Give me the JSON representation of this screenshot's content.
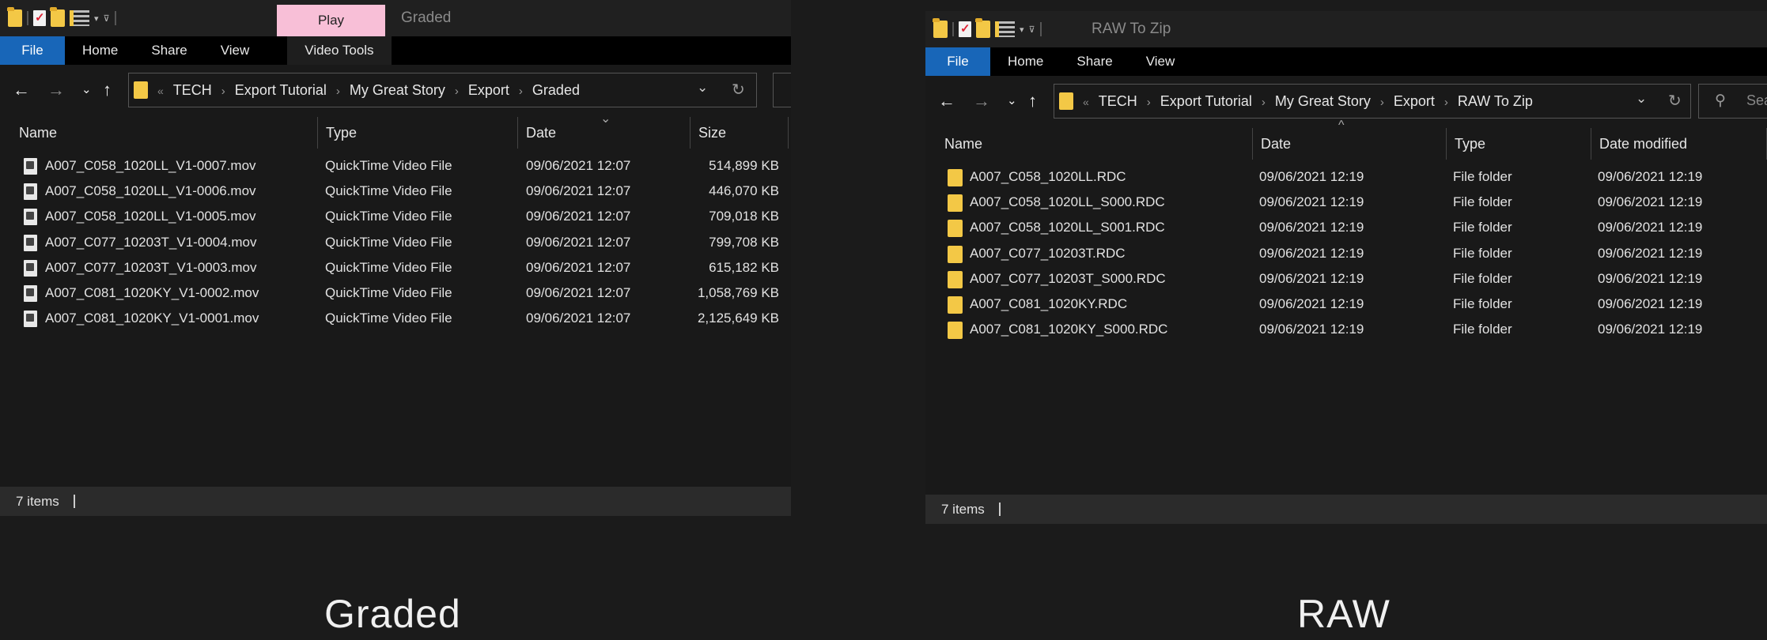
{
  "left_window": {
    "context_tab": "Play",
    "window_title": "Graded",
    "ribbon_tabs": [
      "File",
      "Home",
      "Share",
      "View",
      "Video Tools"
    ],
    "path": [
      "TECH",
      "Export Tutorial",
      "My Great Story",
      "Export",
      "Graded"
    ],
    "columns": [
      "Name",
      "Type",
      "Date",
      "Size"
    ],
    "rows": [
      {
        "name": "A007_C058_1020LL_V1-0007.mov",
        "type": "QuickTime Video File",
        "date": "09/06/2021 12:07",
        "size": "514,899 KB"
      },
      {
        "name": "A007_C058_1020LL_V1-0006.mov",
        "type": "QuickTime Video File",
        "date": "09/06/2021 12:07",
        "size": "446,070 KB"
      },
      {
        "name": "A007_C058_1020LL_V1-0005.mov",
        "type": "QuickTime Video File",
        "date": "09/06/2021 12:07",
        "size": "709,018 KB"
      },
      {
        "name": "A007_C077_10203T_V1-0004.mov",
        "type": "QuickTime Video File",
        "date": "09/06/2021 12:07",
        "size": "799,708 KB"
      },
      {
        "name": "A007_C077_10203T_V1-0003.mov",
        "type": "QuickTime Video File",
        "date": "09/06/2021 12:07",
        "size": "615,182 KB"
      },
      {
        "name": "A007_C081_1020KY_V1-0002.mov",
        "type": "QuickTime Video File",
        "date": "09/06/2021 12:07",
        "size": "1,058,769 KB"
      },
      {
        "name": "A007_C081_1020KY_V1-0001.mov",
        "type": "QuickTime Video File",
        "date": "09/06/2021 12:07",
        "size": "2,125,649 KB"
      }
    ],
    "status": "7 items",
    "icons": {
      "file_row": "video-file-icon",
      "folder": "folder-icon"
    }
  },
  "right_window": {
    "window_title": "RAW To Zip",
    "ribbon_tabs": [
      "File",
      "Home",
      "Share",
      "View"
    ],
    "path": [
      "TECH",
      "Export Tutorial",
      "My Great Story",
      "Export",
      "RAW To Zip"
    ],
    "search_placeholder": "Sea",
    "columns": [
      "Name",
      "Date",
      "Type",
      "Date modified"
    ],
    "rows": [
      {
        "name": "A007_C058_1020LL.RDC",
        "date": "09/06/2021 12:19",
        "type": "File folder",
        "modified": "09/06/2021 12:19"
      },
      {
        "name": "A007_C058_1020LL_S000.RDC",
        "date": "09/06/2021 12:19",
        "type": "File folder",
        "modified": "09/06/2021 12:19"
      },
      {
        "name": "A007_C058_1020LL_S001.RDC",
        "date": "09/06/2021 12:19",
        "type": "File folder",
        "modified": "09/06/2021 12:19"
      },
      {
        "name": "A007_C077_10203T.RDC",
        "date": "09/06/2021 12:19",
        "type": "File folder",
        "modified": "09/06/2021 12:19"
      },
      {
        "name": "A007_C077_10203T_S000.RDC",
        "date": "09/06/2021 12:19",
        "type": "File folder",
        "modified": "09/06/2021 12:19"
      },
      {
        "name": "A007_C081_1020KY.RDC",
        "date": "09/06/2021 12:19",
        "type": "File folder",
        "modified": "09/06/2021 12:19"
      },
      {
        "name": "A007_C081_1020KY_S000.RDC",
        "date": "09/06/2021 12:19",
        "type": "File folder",
        "modified": "09/06/2021 12:19"
      }
    ],
    "status": "7 items"
  },
  "captions": {
    "left": "Graded",
    "right": "RAW"
  },
  "colors": {
    "file_tab": "#1866b8",
    "context_tab": "#f8bfd7",
    "folder": "#f3c846"
  }
}
